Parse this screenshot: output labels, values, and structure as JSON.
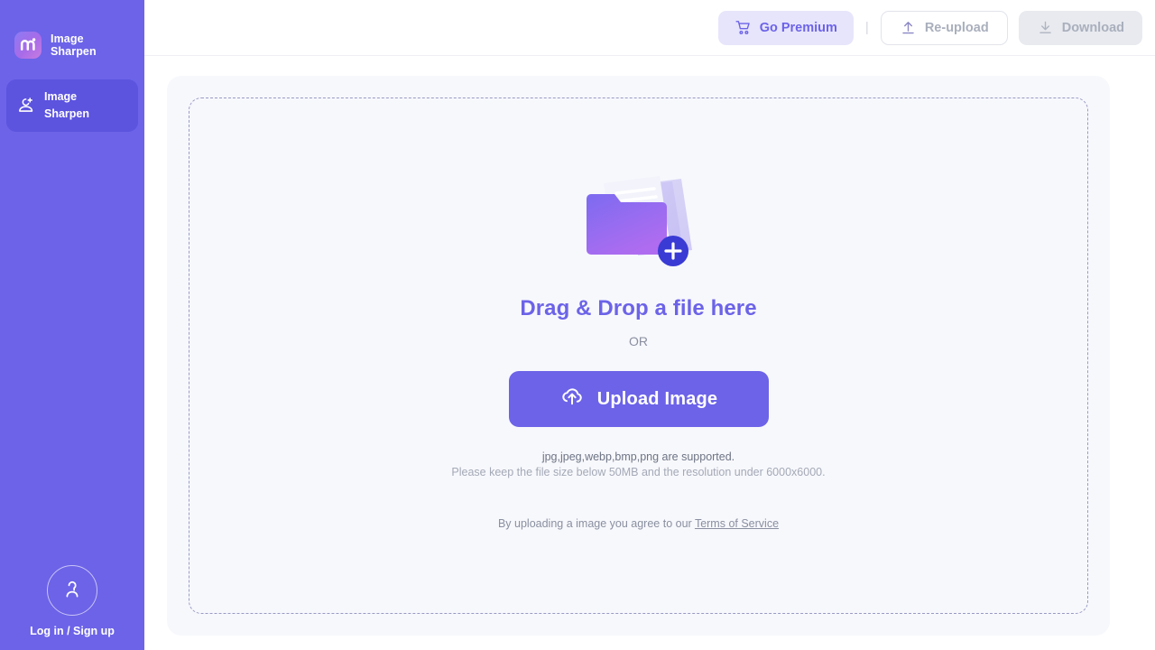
{
  "sidebar": {
    "brand": {
      "name": "Image\nSharpen",
      "logo_icon": "m-logo-icon",
      "logo_gradient_from": "#8C7BF4",
      "logo_gradient_to": "#C87CE0"
    },
    "items": [
      {
        "label": "Image\nSharpen",
        "icon": "user-plus-icon",
        "active": true
      }
    ],
    "account": {
      "avatar_icon": "user-avatar-icon",
      "label": "Log in / Sign up"
    },
    "background": "#6C63E8",
    "active_background": "#5C53DF"
  },
  "topbar": {
    "premium": {
      "label": "Go Premium",
      "icon": "shopping-cart-icon",
      "bg": "#E7E5FB",
      "color": "#6C63E8"
    },
    "separator": "|",
    "reupload": {
      "label": "Re-upload",
      "icon": "upload-arrow-icon",
      "disabled": true
    },
    "download": {
      "label": "Download",
      "icon": "download-icon",
      "disabled": true
    }
  },
  "main": {
    "illustration_icon": "folder-with-files-plus-icon",
    "drag_title": "Drag & Drop a file here",
    "or_text": "OR",
    "upload_button": {
      "label": "Upload Image",
      "icon": "cloud-upload-icon",
      "bg": "#6C63E8"
    },
    "hint_line1": "jpg,jpeg,webp,bmp,png are supported.",
    "hint_line2": "Please keep the file size below 50MB and the resolution under 6000x6000.",
    "terms_prefix": "By uploading a image you agree to our ",
    "terms_link": "Terms of Service"
  }
}
